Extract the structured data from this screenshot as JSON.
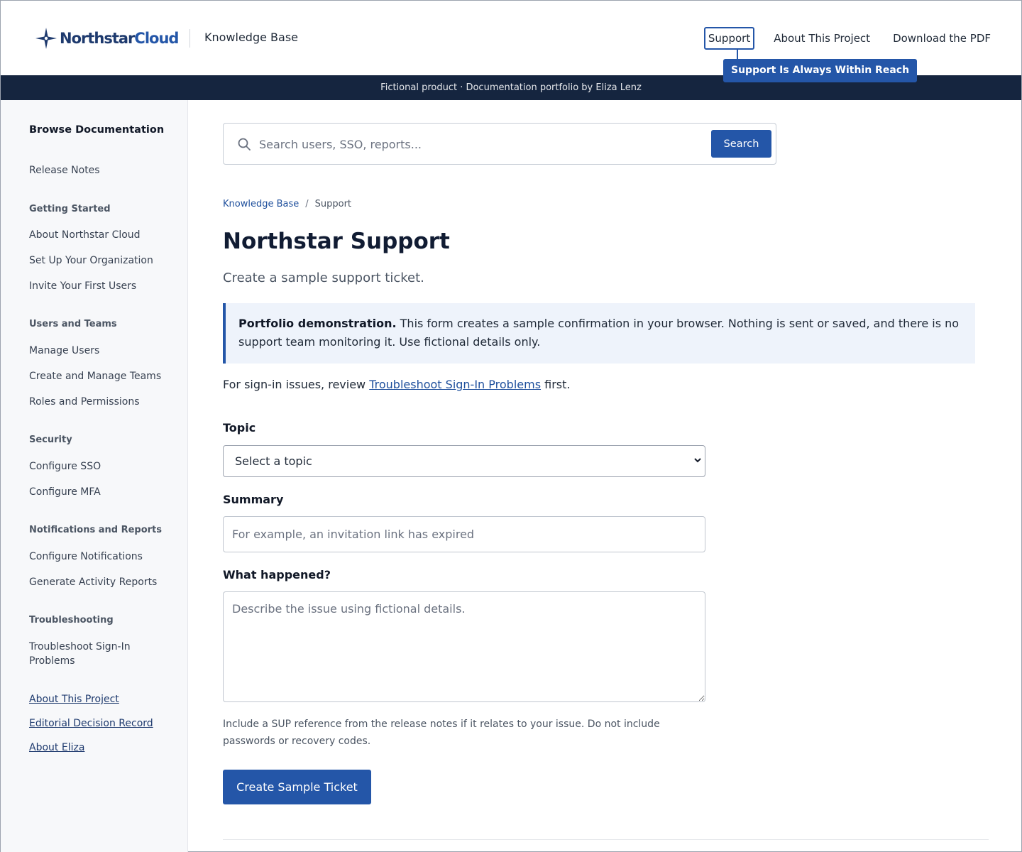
{
  "header": {
    "logo_text_main": "Northstar",
    "logo_text_accent": "Cloud",
    "kb_title": "Knowledge Base",
    "nav": [
      {
        "label": "Support",
        "active": true
      },
      {
        "label": "About This Project",
        "active": false
      },
      {
        "label": "Download the PDF",
        "active": false
      }
    ],
    "tooltip": "Support Is Always Within Reach",
    "brand_color": "#2456a8"
  },
  "banner": {
    "text": "Fictional product · Documentation portfolio by Eliza Lenz",
    "color": "#15253f"
  },
  "sidebar": {
    "title": "Browse Documentation",
    "release_notes": "Release Notes",
    "sections": [
      {
        "heading": "Getting Started",
        "items": [
          "About Northstar Cloud",
          "Set Up Your Organization",
          "Invite Your First Users"
        ]
      },
      {
        "heading": "Users and Teams",
        "items": [
          "Manage Users",
          "Create and Manage Teams",
          "Roles and Permissions"
        ]
      },
      {
        "heading": "Security",
        "items": [
          "Configure SSO",
          "Configure MFA"
        ]
      },
      {
        "heading": "Notifications and Reports",
        "items": [
          "Configure Notifications",
          "Generate Activity Reports"
        ]
      },
      {
        "heading": "Troubleshooting",
        "items": [
          "Troubleshoot Sign-In Problems"
        ]
      }
    ],
    "footer_links": [
      "About This Project",
      "Editorial Decision Record",
      "About Eliza"
    ]
  },
  "search": {
    "placeholder": "Search users, SSO, reports...",
    "button": "Search"
  },
  "breadcrumb": {
    "root": "Knowledge Base",
    "separator": "/",
    "current": "Support"
  },
  "page": {
    "title": "Northstar Support",
    "subtitle": "Create a sample support ticket.",
    "callout_strong": "Portfolio demonstration.",
    "callout_text": " This form creates a sample confirmation in your browser. Nothing is sent or saved, and there is no support team monitoring it. Use fictional details only.",
    "intro_before": "For sign-in issues, review ",
    "intro_link": "Troubleshoot Sign-In Problems",
    "intro_after": " first."
  },
  "form": {
    "topic_label": "Topic",
    "topic_value": "Select a topic",
    "summary_label": "Summary",
    "summary_placeholder": "For example, an invitation link has expired",
    "details_label": "What happened?",
    "details_placeholder": "Describe the issue using fictional details.",
    "hint": "Include a SUP reference from the release notes if it relates to your issue. Do not include passwords or recovery codes.",
    "submit": "Create Sample Ticket"
  }
}
